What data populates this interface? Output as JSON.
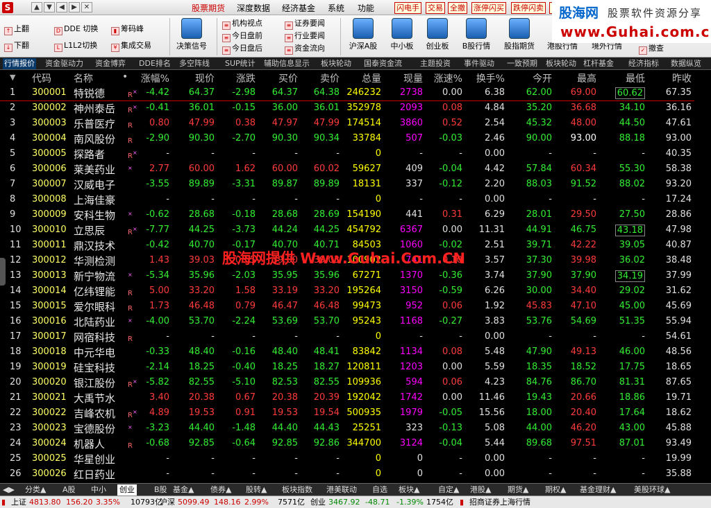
{
  "window": {
    "logo_glyph": "S",
    "controls": [
      "▲",
      "▼",
      "◀",
      "▶",
      "✕"
    ]
  },
  "menu": [
    {
      "label": "股票期货",
      "active": true
    },
    {
      "label": "深度数据",
      "active": false
    },
    {
      "label": "经济基金",
      "active": false
    },
    {
      "label": "系统",
      "active": false
    },
    {
      "label": "功能",
      "active": false
    }
  ],
  "top_buttons": [
    "闪电手",
    "交易",
    "全撤",
    "涨停闪买",
    "跌停闪卖",
    "B"
  ],
  "brand": {
    "name": "股海网",
    "tagline": "股票软件资源分享",
    "url": "www.Guhai.com.cn"
  },
  "toolbar": {
    "small": [
      "上翻",
      "下翻",
      "DDE 切换",
      "L1L2切换",
      "筹码峰",
      "集成交易"
    ],
    "decision": "决策信号",
    "info": [
      "机构视点",
      "今日盘前",
      "今日盘后",
      "证券要闻",
      "行业要闻",
      "资金流向"
    ],
    "big": [
      "沪深A股",
      "中小板",
      "创业板",
      "B股行情",
      "股指期货",
      "港股行情",
      "境外行情"
    ],
    "withdraw": "撤查"
  },
  "subtabs": [
    "行情报价",
    "资金驱动力",
    "资金博弈",
    "DDE排名",
    "多空阵线",
    "SUP统计",
    "辅助信息显示",
    "板块轮动",
    "国泰资金流",
    "主题投资",
    "事件驱动",
    "一致预期",
    "板块轮动",
    "杠杆基金",
    "经济指标",
    "数据纵览"
  ],
  "columns": {
    "sel": "▼",
    "code": "代码",
    "name": "名称",
    "dot": "•",
    "pct": "涨幅%",
    "price": "现价",
    "chg": "涨跌",
    "bid": "买价",
    "ask": "卖价",
    "vol": "总量",
    "cur": "现量",
    "speed": "涨速%",
    "turn": "换手%",
    "open": "今开",
    "high": "最高",
    "low": "最低",
    "prev": "昨收"
  },
  "rows": [
    {
      "idx": "1",
      "code": "300001",
      "name": "特锐德",
      "flag": "R",
      "fx": "×",
      "pct": "-4.42",
      "price": "64.37",
      "chg": "-2.98",
      "bid": "64.37",
      "ask": "64.38",
      "vol": "246232",
      "cur": "2738",
      "speed": "0.00",
      "turn": "6.38",
      "open": "62.00",
      "high": "69.00",
      "low": "60.62",
      "prev": "67.35",
      "dir": "dn",
      "open_c": "dn",
      "high_c": "up",
      "low_c": "dn",
      "cur_c": "vol",
      "speed_c": "eq",
      "low_box": true
    },
    {
      "idx": "2",
      "code": "300002",
      "name": "神州泰岳",
      "flag": "R",
      "fx": "×",
      "pct": "-0.41",
      "price": "36.01",
      "chg": "-0.15",
      "bid": "36.00",
      "ask": "36.01",
      "vol": "352978",
      "cur": "2093",
      "speed": "0.08",
      "turn": "4.84",
      "open": "35.20",
      "high": "36.68",
      "low": "34.10",
      "prev": "36.16",
      "dir": "dn",
      "open_c": "dn",
      "high_c": "up",
      "low_c": "dn",
      "cur_c": "vol",
      "speed_c": "up"
    },
    {
      "idx": "3",
      "code": "300003",
      "name": "乐普医疗",
      "flag": "R",
      "fx": "",
      "pct": "0.80",
      "price": "47.99",
      "chg": "0.38",
      "bid": "47.97",
      "ask": "47.99",
      "vol": "174514",
      "cur": "3860",
      "speed": "0.52",
      "turn": "2.54",
      "open": "45.32",
      "high": "48.00",
      "low": "44.50",
      "prev": "47.61",
      "dir": "up",
      "open_c": "dn",
      "high_c": "up",
      "low_c": "dn",
      "cur_c": "vol",
      "speed_c": "up"
    },
    {
      "idx": "4",
      "code": "300004",
      "name": "南风股份",
      "flag": "R",
      "fx": "",
      "pct": "-2.90",
      "price": "90.30",
      "chg": "-2.70",
      "bid": "90.30",
      "ask": "90.34",
      "vol": "33784",
      "cur": "507",
      "speed": "-0.03",
      "turn": "2.46",
      "open": "90.00",
      "high": "93.00",
      "low": "88.18",
      "prev": "93.00",
      "dir": "dn",
      "open_c": "dn",
      "high_c": "wh",
      "low_c": "dn",
      "cur_c": "vol",
      "speed_c": "dn"
    },
    {
      "idx": "5",
      "code": "300005",
      "name": "探路者",
      "flag": "R",
      "fx": "×",
      "pct": "-",
      "price": "-",
      "chg": "-",
      "bid": "-",
      "ask": "-",
      "vol": "0",
      "cur": "-",
      "speed": "-",
      "turn": "0.00",
      "open": "-",
      "high": "-",
      "low": "-",
      "prev": "40.35",
      "dir": "eq",
      "open_c": "eq",
      "high_c": "eq",
      "low_c": "eq",
      "cur_c": "eq",
      "speed_c": "eq",
      "halt": true
    },
    {
      "idx": "6",
      "code": "300006",
      "name": "莱美药业",
      "flag": "",
      "fx": "×",
      "pct": "2.77",
      "price": "60.00",
      "chg": "1.62",
      "bid": "60.00",
      "ask": "60.02",
      "vol": "59627",
      "cur": "409",
      "speed": "-0.04",
      "turn": "4.42",
      "open": "57.84",
      "high": "60.34",
      "low": "55.30",
      "prev": "58.38",
      "dir": "up",
      "open_c": "dn",
      "high_c": "up",
      "low_c": "dn",
      "cur_c": "eq",
      "speed_c": "dn"
    },
    {
      "idx": "7",
      "code": "300007",
      "name": "汉威电子",
      "flag": "",
      "fx": "",
      "pct": "-3.55",
      "price": "89.89",
      "chg": "-3.31",
      "bid": "89.87",
      "ask": "89.89",
      "vol": "18131",
      "cur": "337",
      "speed": "-0.12",
      "turn": "2.20",
      "open": "88.03",
      "high": "91.52",
      "low": "88.02",
      "prev": "93.20",
      "dir": "dn",
      "open_c": "dn",
      "high_c": "dn",
      "low_c": "dn",
      "cur_c": "eq",
      "speed_c": "dn"
    },
    {
      "idx": "8",
      "code": "300008",
      "name": "上海佳豪",
      "flag": "",
      "fx": "",
      "pct": "-",
      "price": "-",
      "chg": "-",
      "bid": "-",
      "ask": "-",
      "vol": "0",
      "cur": "-",
      "speed": "-",
      "turn": "0.00",
      "open": "-",
      "high": "-",
      "low": "-",
      "prev": "17.24",
      "dir": "eq",
      "open_c": "eq",
      "high_c": "eq",
      "low_c": "eq",
      "cur_c": "eq",
      "speed_c": "eq",
      "halt": true
    },
    {
      "idx": "9",
      "code": "300009",
      "name": "安科生物",
      "flag": "",
      "fx": "×",
      "pct": "-0.62",
      "price": "28.68",
      "chg": "-0.18",
      "bid": "28.68",
      "ask": "28.69",
      "vol": "154190",
      "cur": "441",
      "speed": "0.31",
      "turn": "6.29",
      "open": "28.01",
      "high": "29.50",
      "low": "27.50",
      "prev": "28.86",
      "dir": "dn",
      "open_c": "dn",
      "high_c": "up",
      "low_c": "dn",
      "cur_c": "eq",
      "speed_c": "up"
    },
    {
      "idx": "10",
      "code": "300010",
      "name": "立思辰",
      "flag": "R",
      "fx": "×",
      "pct": "-7.77",
      "price": "44.25",
      "chg": "-3.73",
      "bid": "44.24",
      "ask": "44.25",
      "vol": "454792",
      "cur": "6367",
      "speed": "0.00",
      "turn": "11.31",
      "open": "44.91",
      "high": "46.75",
      "low": "43.18",
      "prev": "47.98",
      "dir": "dn",
      "open_c": "dn",
      "high_c": "dn",
      "low_c": "dn",
      "cur_c": "vol",
      "speed_c": "eq",
      "low_box": true
    },
    {
      "idx": "11",
      "code": "300011",
      "name": "鼎汉技术",
      "flag": "",
      "fx": "",
      "pct": "-0.42",
      "price": "40.70",
      "chg": "-0.17",
      "bid": "40.70",
      "ask": "40.71",
      "vol": "84503",
      "cur": "1060",
      "speed": "-0.02",
      "turn": "2.51",
      "open": "39.71",
      "high": "42.22",
      "low": "39.05",
      "prev": "40.87",
      "dir": "dn",
      "open_c": "dn",
      "high_c": "up",
      "low_c": "dn",
      "cur_c": "vol",
      "speed_c": "dn"
    },
    {
      "idx": "12",
      "code": "300012",
      "name": "华测检测",
      "flag": "",
      "fx": "",
      "pct": "1.43",
      "price": "39.03",
      "chg": "0.55",
      "bid": "39.00",
      "ask": "39.03",
      "vol": "100902",
      "cur": "741",
      "speed": "0.10",
      "turn": "3.57",
      "open": "37.30",
      "high": "39.98",
      "low": "36.02",
      "prev": "38.48",
      "dir": "up",
      "open_c": "dn",
      "high_c": "up",
      "low_c": "dn",
      "cur_c": "vol",
      "speed_c": "up"
    },
    {
      "idx": "13",
      "code": "300013",
      "name": "新宁物流",
      "flag": "",
      "fx": "×",
      "pct": "-5.34",
      "price": "35.96",
      "chg": "-2.03",
      "bid": "35.95",
      "ask": "35.96",
      "vol": "67271",
      "cur": "1370",
      "speed": "-0.36",
      "turn": "3.74",
      "open": "37.90",
      "high": "37.90",
      "low": "34.19",
      "prev": "37.99",
      "dir": "dn",
      "open_c": "dn",
      "high_c": "dn",
      "low_c": "dn",
      "cur_c": "vol",
      "speed_c": "dn",
      "low_box": true
    },
    {
      "idx": "14",
      "code": "300014",
      "name": "亿纬锂能",
      "flag": "R",
      "fx": "",
      "pct": "5.00",
      "price": "33.20",
      "chg": "1.58",
      "bid": "33.19",
      "ask": "33.20",
      "vol": "195264",
      "cur": "3150",
      "speed": "-0.59",
      "turn": "6.26",
      "open": "30.00",
      "high": "34.40",
      "low": "29.02",
      "prev": "31.62",
      "dir": "up",
      "open_c": "dn",
      "high_c": "up",
      "low_c": "dn",
      "cur_c": "vol",
      "speed_c": "dn"
    },
    {
      "idx": "15",
      "code": "300015",
      "name": "爱尔眼科",
      "flag": "R",
      "fx": "",
      "pct": "1.73",
      "price": "46.48",
      "chg": "0.79",
      "bid": "46.47",
      "ask": "46.48",
      "vol": "99473",
      "cur": "952",
      "speed": "0.06",
      "turn": "1.92",
      "open": "45.83",
      "high": "47.10",
      "low": "45.00",
      "prev": "45.69",
      "dir": "up",
      "open_c": "up",
      "high_c": "up",
      "low_c": "dn",
      "cur_c": "vol",
      "speed_c": "up"
    },
    {
      "idx": "16",
      "code": "300016",
      "name": "北陆药业",
      "flag": "",
      "fx": "×",
      "pct": "-4.00",
      "price": "53.70",
      "chg": "-2.24",
      "bid": "53.69",
      "ask": "53.70",
      "vol": "95243",
      "cur": "1168",
      "speed": "-0.27",
      "turn": "3.83",
      "open": "53.76",
      "high": "54.69",
      "low": "51.35",
      "prev": "55.94",
      "dir": "dn",
      "open_c": "dn",
      "high_c": "dn",
      "low_c": "dn",
      "cur_c": "vol",
      "speed_c": "dn"
    },
    {
      "idx": "17",
      "code": "300017",
      "name": "网宿科技",
      "flag": "R",
      "fx": "",
      "pct": "-",
      "price": "-",
      "chg": "-",
      "bid": "-",
      "ask": "-",
      "vol": "0",
      "cur": "-",
      "speed": "-",
      "turn": "0.00",
      "open": "-",
      "high": "-",
      "low": "-",
      "prev": "54.61",
      "dir": "eq",
      "open_c": "eq",
      "high_c": "eq",
      "low_c": "eq",
      "cur_c": "eq",
      "speed_c": "eq",
      "halt": true
    },
    {
      "idx": "18",
      "code": "300018",
      "name": "中元华电",
      "flag": "",
      "fx": "",
      "pct": "-0.33",
      "price": "48.40",
      "chg": "-0.16",
      "bid": "48.40",
      "ask": "48.41",
      "vol": "83842",
      "cur": "1134",
      "speed": "0.08",
      "turn": "5.48",
      "open": "47.90",
      "high": "49.13",
      "low": "46.00",
      "prev": "48.56",
      "dir": "dn",
      "open_c": "dn",
      "high_c": "up",
      "low_c": "dn",
      "cur_c": "vol",
      "speed_c": "up"
    },
    {
      "idx": "19",
      "code": "300019",
      "name": "硅宝科技",
      "flag": "",
      "fx": "",
      "pct": "-2.14",
      "price": "18.25",
      "chg": "-0.40",
      "bid": "18.25",
      "ask": "18.27",
      "vol": "120811",
      "cur": "1203",
      "speed": "0.00",
      "turn": "5.59",
      "open": "18.35",
      "high": "18.52",
      "low": "17.75",
      "prev": "18.65",
      "dir": "dn",
      "open_c": "dn",
      "high_c": "dn",
      "low_c": "dn",
      "cur_c": "vol",
      "speed_c": "eq"
    },
    {
      "idx": "20",
      "code": "300020",
      "name": "银江股份",
      "flag": "R",
      "fx": "×",
      "pct": "-5.82",
      "price": "82.55",
      "chg": "-5.10",
      "bid": "82.53",
      "ask": "82.55",
      "vol": "109936",
      "cur": "594",
      "speed": "0.06",
      "turn": "4.23",
      "open": "84.76",
      "high": "86.70",
      "low": "81.31",
      "prev": "87.65",
      "dir": "dn",
      "open_c": "dn",
      "high_c": "dn",
      "low_c": "dn",
      "cur_c": "vol",
      "speed_c": "up"
    },
    {
      "idx": "21",
      "code": "300021",
      "name": "大禹节水",
      "flag": "",
      "fx": "",
      "pct": "3.40",
      "price": "20.38",
      "chg": "0.67",
      "bid": "20.38",
      "ask": "20.39",
      "vol": "192042",
      "cur": "1742",
      "speed": "0.00",
      "turn": "11.46",
      "open": "19.43",
      "high": "20.66",
      "low": "18.86",
      "prev": "19.71",
      "dir": "up",
      "open_c": "dn",
      "high_c": "up",
      "low_c": "dn",
      "cur_c": "vol",
      "speed_c": "eq"
    },
    {
      "idx": "22",
      "code": "300022",
      "name": "吉峰农机",
      "flag": "R",
      "fx": "×",
      "pct": "4.89",
      "price": "19.53",
      "chg": "0.91",
      "bid": "19.53",
      "ask": "19.54",
      "vol": "500935",
      "cur": "1979",
      "speed": "-0.05",
      "turn": "15.56",
      "open": "18.00",
      "high": "20.40",
      "low": "17.64",
      "prev": "18.62",
      "dir": "up",
      "open_c": "dn",
      "high_c": "up",
      "low_c": "dn",
      "cur_c": "vol",
      "speed_c": "dn"
    },
    {
      "idx": "23",
      "code": "300023",
      "name": "宝德股份",
      "flag": "",
      "fx": "×",
      "pct": "-3.23",
      "price": "44.40",
      "chg": "-1.48",
      "bid": "44.40",
      "ask": "44.43",
      "vol": "25251",
      "cur": "323",
      "speed": "-0.13",
      "turn": "5.08",
      "open": "44.00",
      "high": "46.20",
      "low": "43.00",
      "prev": "45.88",
      "dir": "dn",
      "open_c": "dn",
      "high_c": "up",
      "low_c": "dn",
      "cur_c": "eq",
      "speed_c": "dn"
    },
    {
      "idx": "24",
      "code": "300024",
      "name": "机器人",
      "flag": "R",
      "fx": "",
      "pct": "-0.68",
      "price": "92.85",
      "chg": "-0.64",
      "bid": "92.85",
      "ask": "92.86",
      "vol": "344700",
      "cur": "3124",
      "speed": "-0.04",
      "turn": "5.44",
      "open": "89.68",
      "high": "97.51",
      "low": "87.01",
      "prev": "93.49",
      "dir": "dn",
      "open_c": "dn",
      "high_c": "up",
      "low_c": "dn",
      "cur_c": "vol",
      "speed_c": "dn"
    },
    {
      "idx": "25",
      "code": "300025",
      "name": "华星创业",
      "flag": "",
      "fx": "",
      "pct": "-",
      "price": "-",
      "chg": "-",
      "bid": "-",
      "ask": "-",
      "vol": "0",
      "cur": "0",
      "speed": "-",
      "turn": "0.00",
      "open": "-",
      "high": "-",
      "low": "-",
      "prev": "19.99",
      "dir": "eq",
      "open_c": "eq",
      "high_c": "eq",
      "low_c": "eq",
      "cur_c": "eq",
      "speed_c": "eq",
      "halt": true
    },
    {
      "idx": "26",
      "code": "300026",
      "name": "红日药业",
      "flag": "",
      "fx": "",
      "pct": "-",
      "price": "-",
      "chg": "-",
      "bid": "-",
      "ask": "-",
      "vol": "0",
      "cur": "0",
      "speed": "-",
      "turn": "0.00",
      "open": "-",
      "high": "-",
      "low": "-",
      "prev": "35.88",
      "dir": "eq",
      "open_c": "eq",
      "high_c": "eq",
      "low_c": "eq",
      "cur_c": "eq",
      "speed_c": "eq",
      "halt": true
    }
  ],
  "watermark": "股海网提供 Www.Guhai.Com.CN",
  "sheet_tabs": [
    {
      "label": "分类▲",
      "active": false
    },
    {
      "label": "A股",
      "active": false
    },
    {
      "label": "中小",
      "active": false
    },
    {
      "label": "创业",
      "active": true
    },
    {
      "label": "B股",
      "active": false
    },
    {
      "label": "基金▲",
      "active": false
    },
    {
      "label": "债券▲",
      "active": false
    },
    {
      "label": "股转▲",
      "active": false
    },
    {
      "label": "板块指数",
      "active": false
    },
    {
      "label": "港美联动",
      "active": false
    },
    {
      "label": "自选",
      "active": false
    },
    {
      "label": "板块▲",
      "active": false
    },
    {
      "label": "自定▲",
      "active": false
    },
    {
      "label": "港股▲",
      "active": false
    },
    {
      "label": "期货▲",
      "active": false
    },
    {
      "label": "期权▲",
      "active": false
    },
    {
      "label": "基金理财▲",
      "active": false
    },
    {
      "label": "美股环球▲",
      "active": false
    }
  ],
  "status": {
    "sh_label": "上证",
    "sh_val": "4813.80",
    "sh_chg": "156.20",
    "sh_pct": "3.35%",
    "sh_amt": "10793亿",
    "sz_label": "沪深",
    "sz_val": "5099.49",
    "sz_chg": "148.16",
    "sz_pct": "2.99%",
    "sz_amt": "7571亿",
    "cy_label": "创业",
    "cy_val": "3467.92",
    "cy_chg": "-48.71",
    "cy_pct": "-1.39%",
    "cy_amt": "1754亿",
    "broker": "招商证券上海行情"
  },
  "colors": {
    "up": "#ff3b3b",
    "down": "#33ee33",
    "code": "#ffff66",
    "volume": "#ff00ff",
    "background": "#000000"
  }
}
